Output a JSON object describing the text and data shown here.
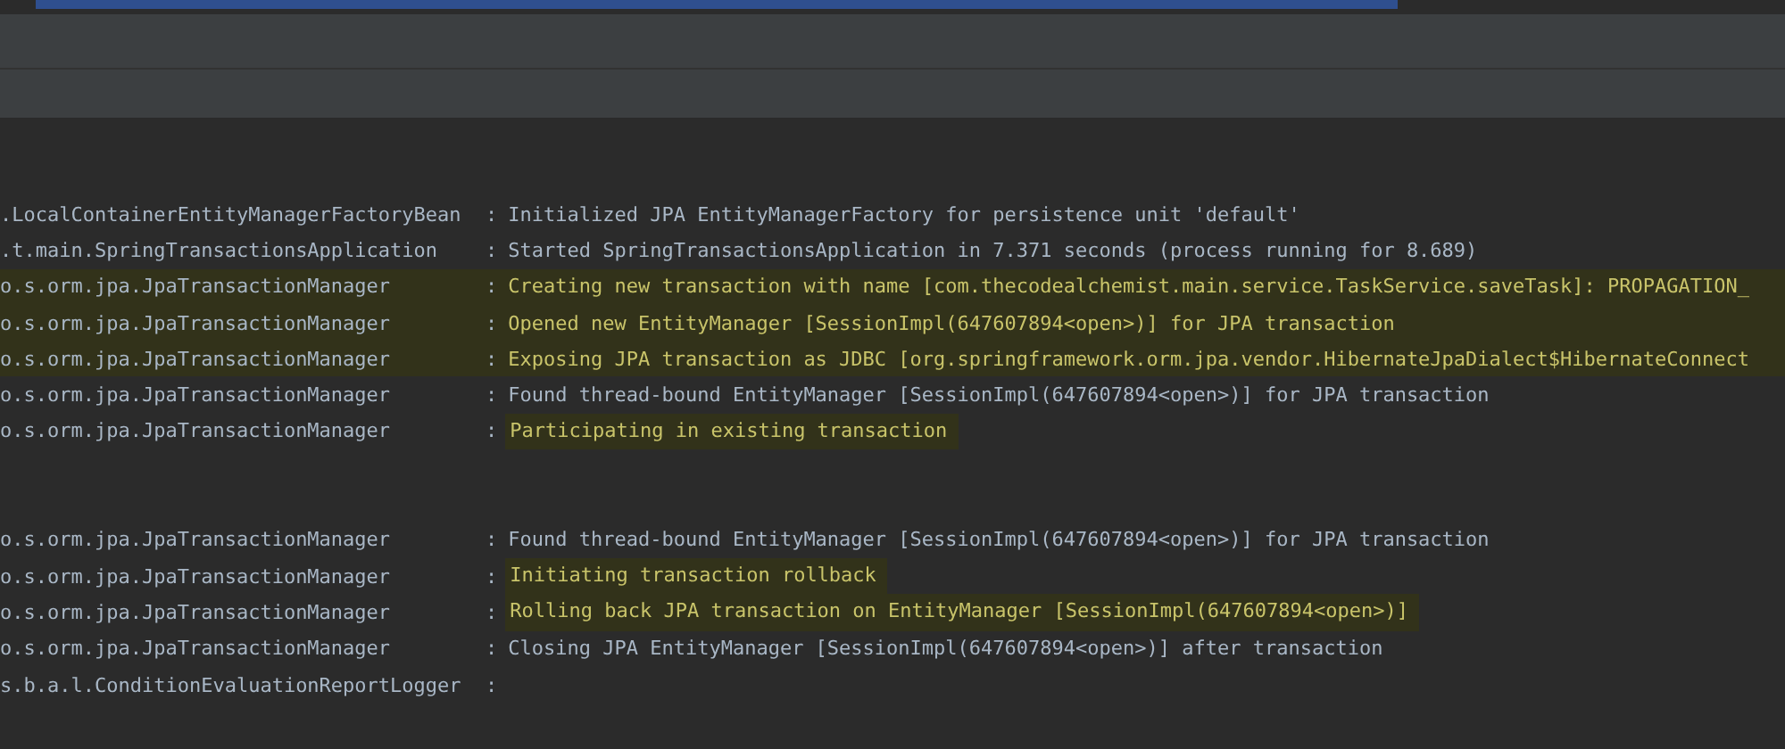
{
  "console": {
    "blocks": [
      {
        "lines": [
          {
            "logger": ".LocalContainerEntityManagerFactoryBean",
            "separator": ":",
            "message": "Initialized JPA EntityManagerFactory for persistence unit 'default'",
            "row_highlighted": false,
            "message_highlighted": false
          },
          {
            "logger": ".t.main.SpringTransactionsApplication",
            "separator": ":",
            "message": "Started SpringTransactionsApplication in 7.371 seconds (process running for 8.689)",
            "row_highlighted": false,
            "message_highlighted": false
          },
          {
            "logger": "o.s.orm.jpa.JpaTransactionManager",
            "separator": ":",
            "message": "Creating new transaction with name [com.thecodealchemist.main.service.TaskService.saveTask]: PROPAGATION_",
            "row_highlighted": true,
            "message_highlighted": false
          },
          {
            "logger": "o.s.orm.jpa.JpaTransactionManager",
            "separator": ":",
            "message": "Opened new EntityManager [SessionImpl(647607894<open>)] for JPA transaction",
            "row_highlighted": true,
            "message_highlighted": false
          },
          {
            "logger": "o.s.orm.jpa.JpaTransactionManager",
            "separator": ":",
            "message": "Exposing JPA transaction as JDBC [org.springframework.orm.jpa.vendor.HibernateJpaDialect$HibernateConnect",
            "row_highlighted": true,
            "message_highlighted": false
          },
          {
            "logger": "o.s.orm.jpa.JpaTransactionManager",
            "separator": ":",
            "message": "Found thread-bound EntityManager [SessionImpl(647607894<open>)] for JPA transaction",
            "row_highlighted": false,
            "message_highlighted": false
          },
          {
            "logger": "o.s.orm.jpa.JpaTransactionManager",
            "separator": ":",
            "message": "Participating in existing transaction",
            "row_highlighted": false,
            "message_highlighted": true
          }
        ]
      },
      {
        "lines": [
          {
            "logger": "o.s.orm.jpa.JpaTransactionManager",
            "separator": ":",
            "message": "Found thread-bound EntityManager [SessionImpl(647607894<open>)] for JPA transaction",
            "row_highlighted": false,
            "message_highlighted": false
          },
          {
            "logger": "o.s.orm.jpa.JpaTransactionManager",
            "separator": ":",
            "message": "Initiating transaction rollback",
            "row_highlighted": false,
            "message_highlighted": true
          },
          {
            "logger": "o.s.orm.jpa.JpaTransactionManager",
            "separator": ":",
            "message": "Rolling back JPA transaction on EntityManager [SessionImpl(647607894<open>)]",
            "row_highlighted": false,
            "message_highlighted": true
          },
          {
            "logger": "o.s.orm.jpa.JpaTransactionManager",
            "separator": ":",
            "message": "Closing JPA EntityManager [SessionImpl(647607894<open>)] after transaction",
            "row_highlighted": false,
            "message_highlighted": false
          },
          {
            "logger": "s.b.a.l.ConditionEvaluationReportLogger",
            "separator": ":"
          }
        ]
      }
    ]
  }
}
